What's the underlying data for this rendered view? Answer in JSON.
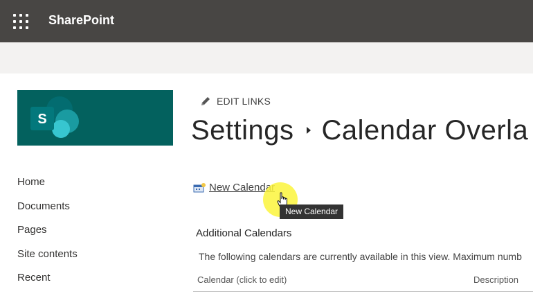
{
  "suitebar": {
    "brand": "SharePoint",
    "background": "#484644",
    "waffle_icon": "app-launcher-icon"
  },
  "site": {
    "logo_color": "#03615e",
    "logo_letter": "S"
  },
  "nav": {
    "items": [
      {
        "label": "Home"
      },
      {
        "label": "Documents"
      },
      {
        "label": "Pages"
      },
      {
        "label": "Site contents"
      },
      {
        "label": "Recent"
      }
    ]
  },
  "edit_links": {
    "label": "EDIT LINKS",
    "icon": "pencil-icon"
  },
  "title": {
    "parent": "Settings",
    "current": "Calendar Overla"
  },
  "actions": {
    "new_calendar": "New Calendar",
    "new_calendar_icon": "new-calendar-icon",
    "tooltip": "New Calendar"
  },
  "section": {
    "heading": "Additional Calendars",
    "description": "The following calendars are currently available in this view. Maximum numb",
    "columns": [
      "Calendar (click to edit)",
      "Description"
    ]
  }
}
